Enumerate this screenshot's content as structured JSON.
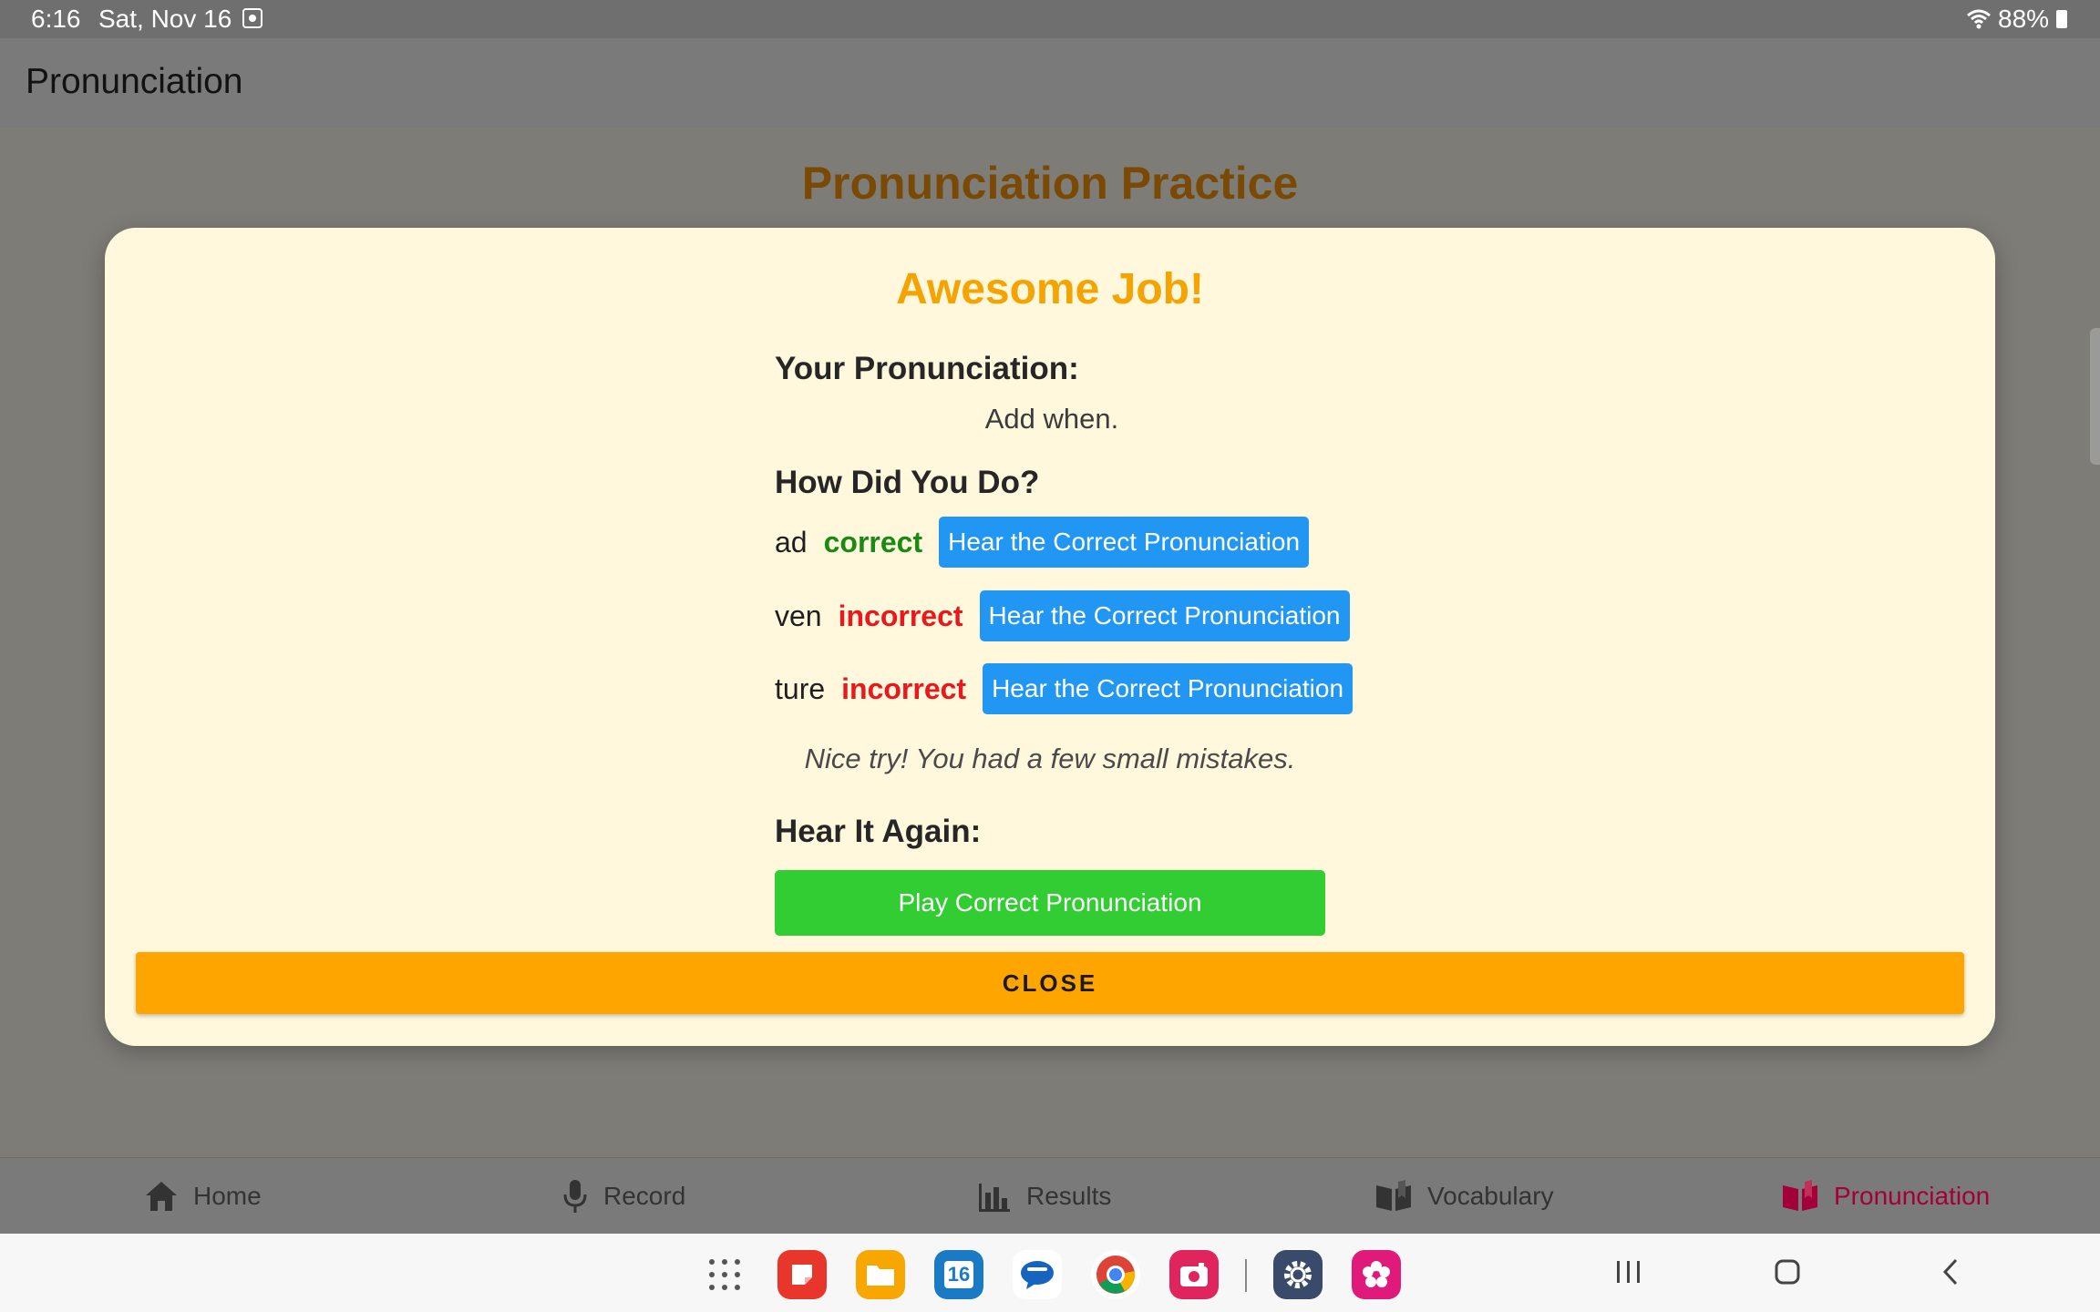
{
  "status_bar": {
    "time": "6:16",
    "date": "Sat, Nov 16",
    "battery": "88%"
  },
  "app_bar": {
    "title": "Pronunciation"
  },
  "page": {
    "heading": "Pronunciation Practice"
  },
  "dialog": {
    "title": "Awesome Job!",
    "your_pronunciation_label": "Your Pronunciation:",
    "recognized_text": "Add when.",
    "how_did_you_do_label": "How Did You Do?",
    "syllables": [
      {
        "syllable": "ad",
        "status": "correct",
        "button": "Hear the Correct Pronunciation"
      },
      {
        "syllable": "ven",
        "status": "incorrect",
        "button": "Hear the Correct Pronunciation"
      },
      {
        "syllable": "ture",
        "status": "incorrect",
        "button": "Hear the Correct Pronunciation"
      }
    ],
    "feedback": "Nice try! You had a few small mistakes.",
    "hear_again_label": "Hear It Again:",
    "play_button": "Play Correct Pronunciation",
    "close_button": "CLOSE"
  },
  "bottom_nav": {
    "items": [
      {
        "label": "Home",
        "icon": "home-icon"
      },
      {
        "label": "Record",
        "icon": "microphone-icon"
      },
      {
        "label": "Results",
        "icon": "bar-chart-icon"
      },
      {
        "label": "Vocabulary",
        "icon": "book-icon"
      },
      {
        "label": "Pronunciation",
        "icon": "book-icon",
        "active": true
      }
    ]
  },
  "taskbar": {
    "apps": [
      "app-drawer-icon",
      "notes-app-icon",
      "files-app-icon",
      "calendar-app-icon",
      "messages-app-icon",
      "chrome-app-icon",
      "camera-app-icon",
      "settings-app-icon",
      "gallery-app-icon"
    ],
    "calendar_day": "16"
  },
  "colors": {
    "accent_orange": "#ffa500",
    "title_orange": "#f5a300",
    "correct_green": "#1a8a14",
    "incorrect_red": "#e8181c",
    "hear_button_blue": "#2196f3",
    "play_button_green": "#32cd32",
    "dialog_bg": "#fff8dc",
    "active_nav": "#a3003a"
  }
}
